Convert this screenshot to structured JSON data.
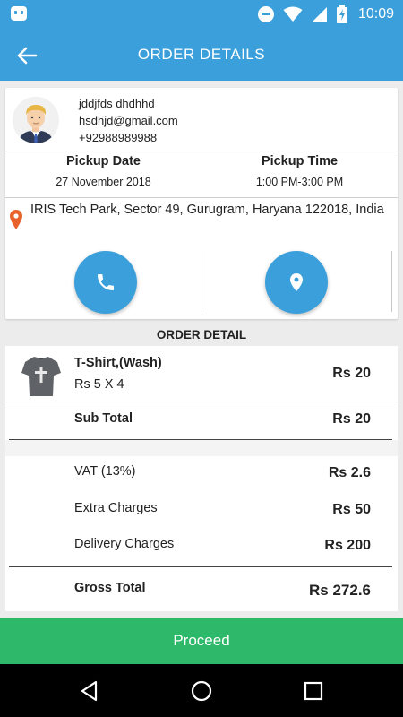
{
  "status_bar": {
    "time": "10:09",
    "icons": [
      "android-icon",
      "do-not-disturb-icon",
      "wifi-icon",
      "signal-icon",
      "battery-charging-icon"
    ]
  },
  "app_bar": {
    "title": "ORDER DETAILS",
    "back_icon": "back-arrow-icon"
  },
  "customer": {
    "name": "jddjfds dhdhhd",
    "email": "hsdhjd@gmail.com",
    "phone": "+92988989988"
  },
  "pickup": {
    "date_label": "Pickup Date",
    "date_value": "27 November 2018",
    "time_label": "Pickup Time",
    "time_value": "1:00 PM-3:00 PM"
  },
  "address": "IRIS Tech Park, Sector 49, Gurugram, Haryana 122018, India",
  "actions": {
    "call_icon": "phone-icon",
    "location_icon": "location-pin-icon"
  },
  "order": {
    "section_title": "ORDER DETAIL",
    "items": [
      {
        "name": "T-Shirt,(Wash)",
        "qty": "Rs 5 X 4",
        "price": "Rs 20"
      }
    ],
    "subtotal_label": "Sub Total",
    "subtotal_value": "Rs 20",
    "vat_label": "VAT (13%)",
    "vat_value": "Rs 2.6",
    "extra_label": "Extra Charges",
    "extra_value": "Rs 50",
    "delivery_label": "Delivery Charges",
    "delivery_value": "Rs 200",
    "gross_label": "Gross Total",
    "gross_value": "Rs 272.6"
  },
  "proceed_label": "Proceed",
  "colors": {
    "primary": "#3a9fda",
    "proceed": "#2eb869",
    "pin": "#e8632b"
  }
}
